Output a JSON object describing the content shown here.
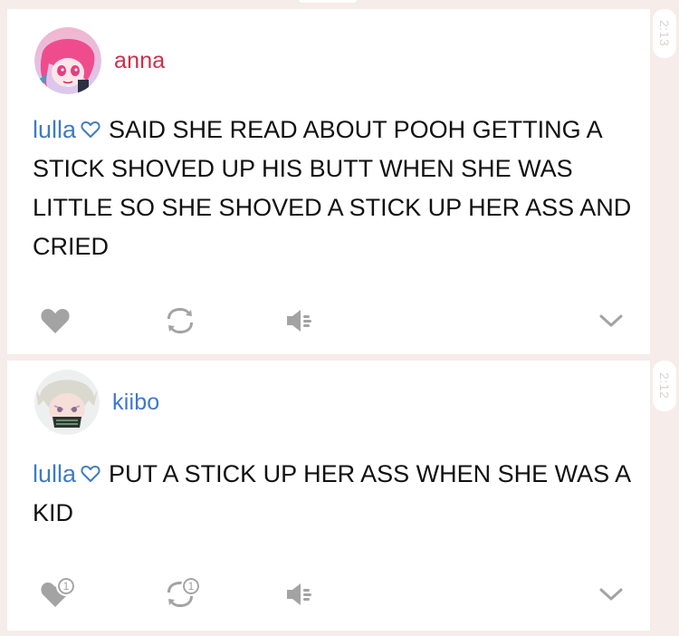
{
  "posts": [
    {
      "username": "anna",
      "mention": "lulla",
      "text": "SAID SHE READ ABOUT POOH GETTING A STICK SHOVED UP HIS BUTT WHEN SHE WAS LITTLE SO SHE SHOVED A STICK UP HER ASS AND CRIED",
      "timestamp": "2:13",
      "accent": "#cf2c4b",
      "actions": [
        {
          "name": "like",
          "icon": "heart-icon",
          "count": ""
        },
        {
          "name": "reblog",
          "icon": "reblog-icon",
          "count": ""
        },
        {
          "name": "speaker",
          "icon": "speaker-icon",
          "count": ""
        },
        {
          "name": "more",
          "icon": "chevron-down-icon",
          "count": ""
        }
      ]
    },
    {
      "username": "kiibo",
      "mention": "lulla",
      "text": "PUT A STICK UP HER ASS WHEN SHE WAS A KID",
      "timestamp": "2:12",
      "accent": "#3f77cf",
      "actions": [
        {
          "name": "like",
          "icon": "heart-icon",
          "count": "1"
        },
        {
          "name": "reblog",
          "icon": "reblog-icon",
          "count": "1"
        },
        {
          "name": "speaker",
          "icon": "speaker-icon",
          "count": ""
        },
        {
          "name": "more",
          "icon": "chevron-down-icon",
          "count": ""
        }
      ]
    }
  ],
  "colors": {
    "background": "#f6ece9",
    "mention": "#3e7cc3",
    "icon": "#a3a3a3",
    "timestamp": "#d9d3d0"
  }
}
